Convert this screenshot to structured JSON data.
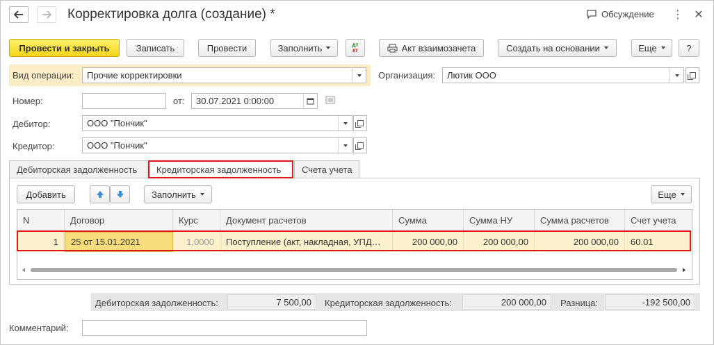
{
  "window": {
    "title": "Корректировка долга (создание) *",
    "discussion_label": "Обсуждение"
  },
  "toolbar": {
    "post_close": "Провести и закрыть",
    "save": "Записать",
    "post": "Провести",
    "fill": "Заполнить",
    "dt_kt_top": "дт",
    "dt_kt_bottom": "кт",
    "offset_act": "Акт взаимозачета",
    "create_based": "Создать на основании",
    "more": "Еще",
    "help": "?"
  },
  "form": {
    "operation_label": "Вид операции:",
    "operation_value": "Прочие корректировки",
    "organization_label": "Организация:",
    "organization_value": "Лютик ООО",
    "number_label": "Номер:",
    "number_value": "",
    "date_label": "от:",
    "date_value": "30.07.2021  0:00:00",
    "debtor_label": "Дебитор:",
    "debtor_value": "ООО \"Пончик\"",
    "creditor_label": "Кредитор:",
    "creditor_value": "ООО \"Пончик\"",
    "comment_label": "Комментарий:",
    "comment_value": ""
  },
  "tabs": [
    {
      "label": "Дебиторская задолженность"
    },
    {
      "label": "Кредиторская задолженность"
    },
    {
      "label": "Счета учета"
    }
  ],
  "table_toolbar": {
    "add": "Добавить",
    "fill": "Заполнить",
    "more": "Еще"
  },
  "table": {
    "columns": [
      "N",
      "Договор",
      "Курс",
      "Документ расчетов",
      "Сумма",
      "Сумма НУ",
      "Сумма расчетов",
      "Счет учета"
    ],
    "rows": [
      {
        "n": "1",
        "contract": "25 от 15.01.2021",
        "rate": "1,0000",
        "document": "Поступление (акт, накладная, УПД…",
        "sum": "200 000,00",
        "sum_nu": "200 000,00",
        "sum_settlement": "200 000,00",
        "account": "60.01"
      }
    ]
  },
  "totals": {
    "receivable_label": "Дебиторская задолженность:",
    "receivable_value": "7 500,00",
    "payable_label": "Кредиторская задолженность:",
    "payable_value": "200 000,00",
    "diff_label": "Разница:",
    "diff_value": "-192 500,00"
  },
  "colors": {
    "primary_button": "#f5d519",
    "highlight": "#e0161d",
    "selected_row": "#fbf1cc"
  }
}
